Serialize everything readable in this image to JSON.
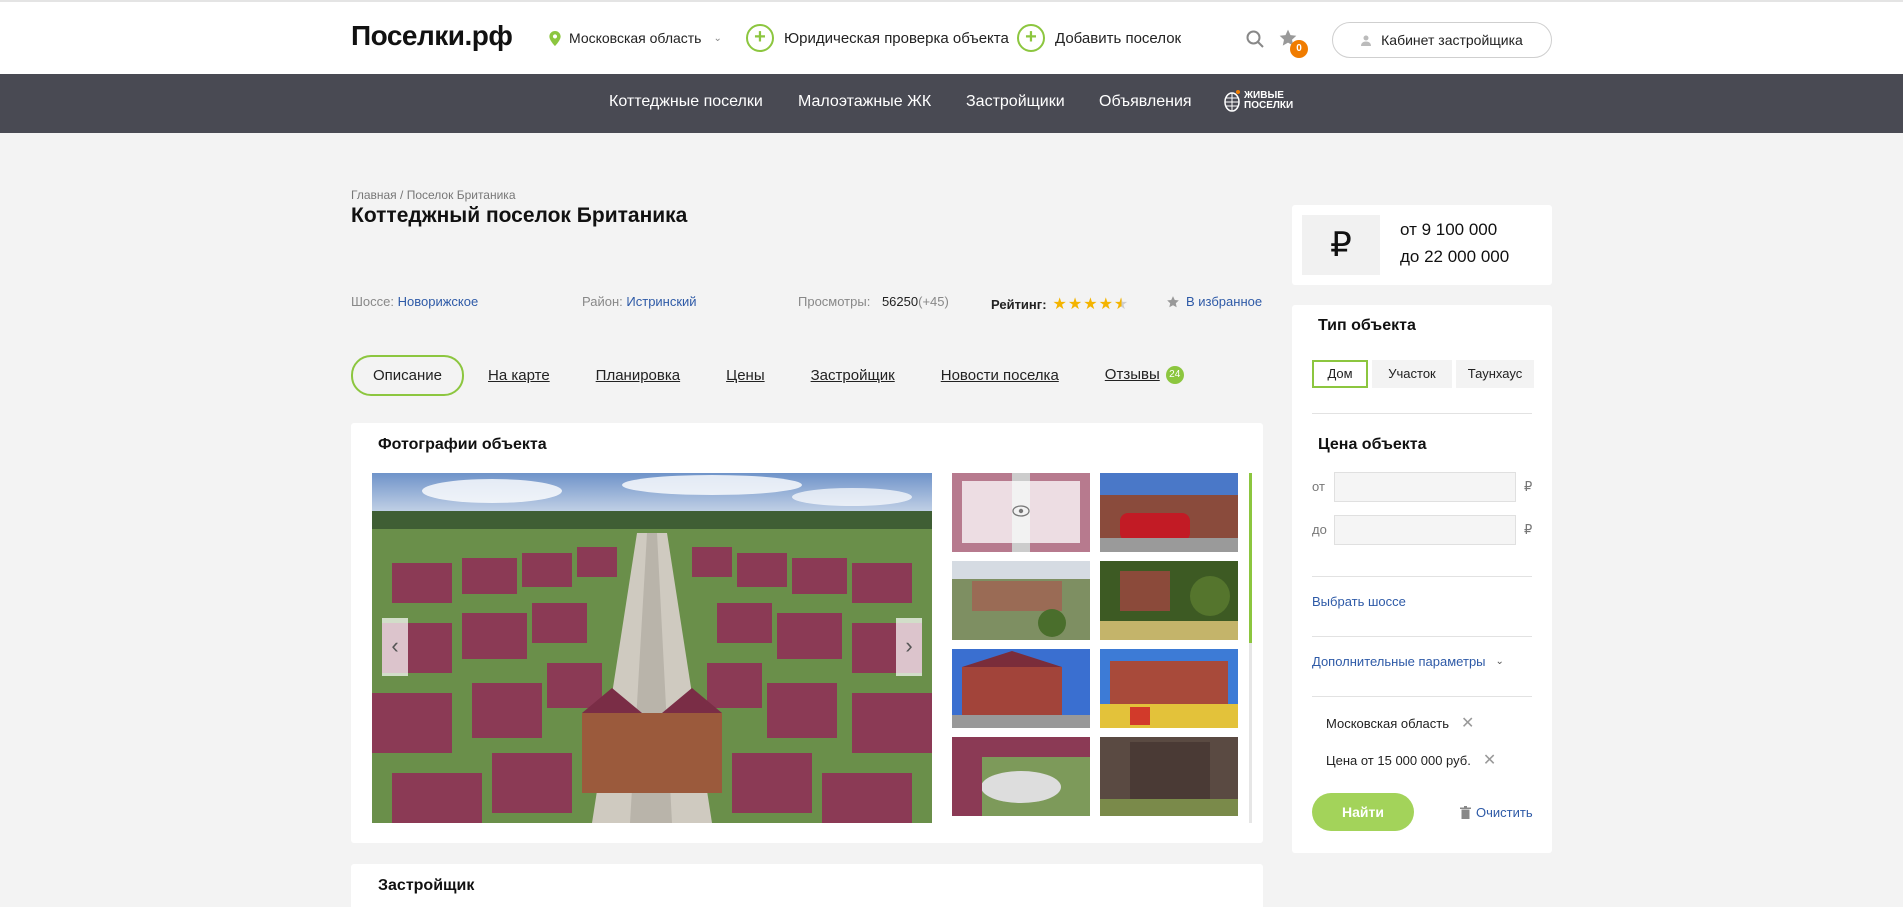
{
  "header": {
    "logo": "Поселки.рф",
    "region": "Московская область",
    "legal_check": "Юридическая проверка объекта",
    "add_village": "Добавить поселок",
    "favorites_count": "0",
    "cabinet": "Кабинет застройщика"
  },
  "nav": {
    "items": [
      "Коттеджные поселки",
      "Малоэтажные ЖК",
      "Застройщики",
      "Объявления"
    ],
    "live_logo_line1": "ЖИВЫЕ",
    "live_logo_line2": "ПОСЕЛКИ"
  },
  "breadcrumb": {
    "home": "Главная",
    "sep": "/",
    "current": "Поселок Британика"
  },
  "page_title": "Коттеджный поселок Британика",
  "meta": {
    "highway_label": "Шоссе:",
    "highway": "Новорижское",
    "district_label": "Район:",
    "district": "Истринский",
    "views_label": "Просмотры:",
    "views": "56250",
    "views_delta": "(+45)",
    "rating_label": "Рейтинг:",
    "rating": 4.5,
    "to_favorites": "В избранное"
  },
  "tabs": [
    "Описание",
    "На карте",
    "Планировка",
    "Цены",
    "Застройщик",
    "Новости поселка",
    "Отзывы"
  ],
  "reviews_count": "24",
  "photos_title": "Фотографии объекта",
  "developer_title": "Застройщик",
  "price": {
    "currency": "₽",
    "from": "от 9 100 000",
    "to": "до 22 000 000"
  },
  "filter": {
    "type_title": "Тип объекта",
    "types": [
      "Дом",
      "Участок",
      "Таунхаус"
    ],
    "price_title": "Цена объекта",
    "from_label": "от",
    "to_label": "до",
    "currency": "₽",
    "highway_link": "Выбрать шоссе",
    "more_params": "Дополнительные параметры",
    "chips": [
      "Московская область",
      "Цена от 15 000 000 руб."
    ],
    "find": "Найти",
    "clear": "Очистить"
  },
  "colors": {
    "accent": "#8cc63f",
    "nav_bg": "#494a53",
    "link": "#2e5aa7",
    "badge": "#f07c00"
  }
}
